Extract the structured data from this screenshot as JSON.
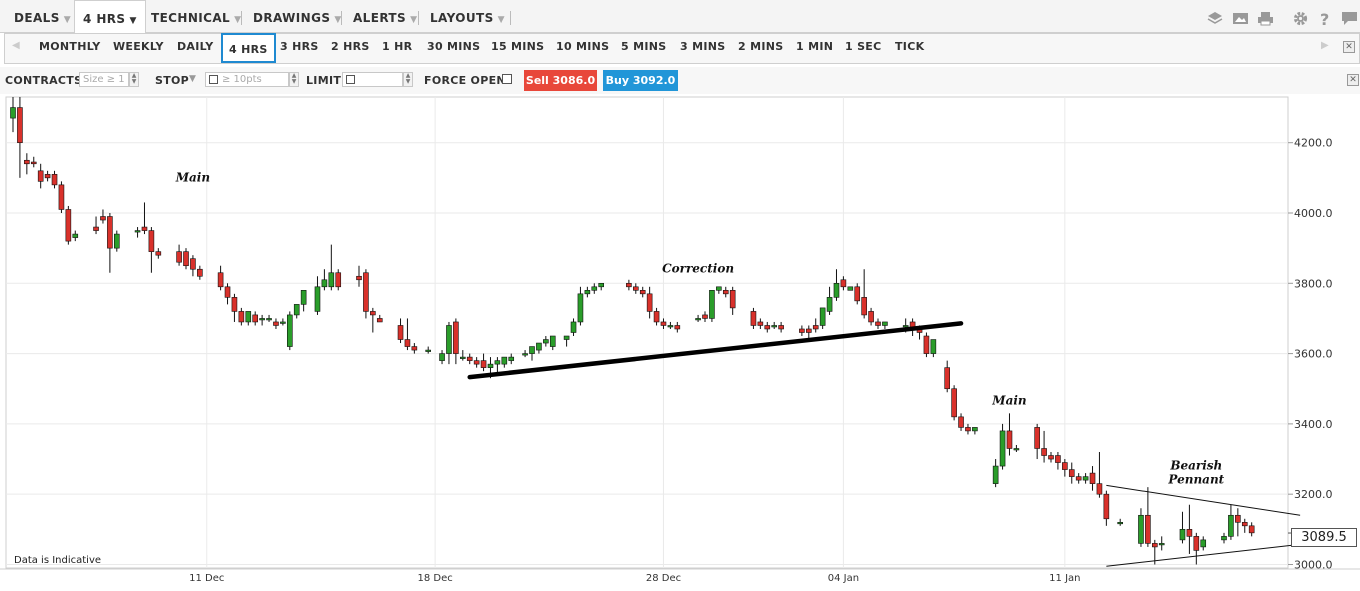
{
  "menus": [
    {
      "label": "DEALS",
      "active": false
    },
    {
      "label": "4 HRS",
      "active": true
    },
    {
      "label": "TECHNICAL",
      "active": false
    },
    {
      "label": "DRAWINGS",
      "active": false
    },
    {
      "label": "ALERTS",
      "active": false
    },
    {
      "label": "LAYOUTS",
      "active": false
    }
  ],
  "toolbar_icons": [
    "layers-icon",
    "image-icon",
    "print-icon",
    "gear-icon",
    "help-icon",
    "chat-icon"
  ],
  "timeframes": [
    "MONTHLY",
    "WEEKLY",
    "DAILY",
    "4 HRS",
    "3 HRS",
    "2 HRS",
    "1 HR",
    "30 MINS",
    "15 MINS",
    "10 MINS",
    "5 MINS",
    "3 MINS",
    "2 MINS",
    "1 MIN",
    "1 SEC",
    "TICK"
  ],
  "selected_timeframe": "4 HRS",
  "order": {
    "contracts_label": "CONTRACTS",
    "contracts_placeholder": "Size ≥ 1",
    "stop_label": "STOP",
    "stop_placeholder": "≥ 10pts",
    "limit_label": "LIMIT",
    "force_open_label": "FORCE OPEN",
    "sell_label": "Sell 3086.0",
    "buy_label": "Buy 3092.0",
    "sell_color": "#e8473a",
    "buy_color": "#2196d8"
  },
  "disclaimer": "Data is Indicative",
  "current_price": "3089.5",
  "chart_data": {
    "type": "candlestick",
    "title": "",
    "xlabel": "",
    "ylabel": "",
    "ylim": [
      2990,
      4330
    ],
    "yticks": [
      3000,
      3200,
      3400,
      3600,
      3800,
      4000,
      4200
    ],
    "ytick_labels": [
      "3000.0",
      "3200.0",
      "3400.0",
      "3600.0",
      "3800.0",
      "4000.0",
      "4200.0"
    ],
    "xticks": [
      {
        "label": "11 Dec",
        "index": 28
      },
      {
        "label": "18 Dec",
        "index": 61
      },
      {
        "label": "28 Dec",
        "index": 94
      },
      {
        "label": "04 Jan",
        "index": 120
      },
      {
        "label": "11 Jan",
        "index": 152
      }
    ],
    "grid": true,
    "bar_count": 179,
    "candles": [
      [
        0,
        4270,
        4330,
        4300,
        4230
      ],
      [
        1,
        4300,
        4330,
        4200,
        4100
      ],
      [
        2,
        4150,
        4170,
        4140,
        4110
      ],
      [
        3,
        4145,
        4160,
        4140,
        4130
      ],
      [
        4,
        4120,
        4140,
        4090,
        4070
      ],
      [
        5,
        4110,
        4120,
        4100,
        4090
      ],
      [
        6,
        4110,
        4120,
        4080,
        4070
      ],
      [
        7,
        4080,
        4090,
        4010,
        4000
      ],
      [
        8,
        4010,
        4020,
        3920,
        3910
      ],
      [
        9,
        3930,
        3950,
        3940,
        3920
      ],
      [
        12,
        3960,
        3990,
        3950,
        3940
      ],
      [
        13,
        3990,
        4010,
        3980,
        3970
      ],
      [
        14,
        3990,
        4000,
        3900,
        3830
      ],
      [
        15,
        3900,
        3950,
        3940,
        3890
      ],
      [
        18,
        3950,
        3960,
        3950,
        3930
      ],
      [
        19,
        3960,
        4030,
        3950,
        3940
      ],
      [
        20,
        3950,
        3960,
        3890,
        3830
      ],
      [
        21,
        3890,
        3900,
        3880,
        3870
      ],
      [
        24,
        3890,
        3910,
        3860,
        3850
      ],
      [
        25,
        3890,
        3900,
        3850,
        3840
      ],
      [
        26,
        3870,
        3880,
        3840,
        3820
      ],
      [
        27,
        3840,
        3850,
        3820,
        3810
      ],
      [
        30,
        3830,
        3850,
        3790,
        3780
      ],
      [
        31,
        3790,
        3800,
        3760,
        3740
      ],
      [
        32,
        3760,
        3770,
        3720,
        3690
      ],
      [
        33,
        3720,
        3730,
        3690,
        3680
      ],
      [
        34,
        3690,
        3700,
        3720,
        3680
      ],
      [
        35,
        3710,
        3720,
        3690,
        3680
      ],
      [
        36,
        3700,
        3710,
        3700,
        3680
      ],
      [
        37,
        3700,
        3710,
        3700,
        3690
      ],
      [
        38,
        3690,
        3700,
        3680,
        3670
      ],
      [
        39,
        3690,
        3700,
        3690,
        3680
      ],
      [
        40,
        3620,
        3720,
        3710,
        3610
      ],
      [
        41,
        3710,
        3740,
        3740,
        3700
      ],
      [
        42,
        3740,
        3760,
        3780,
        3720
      ],
      [
        44,
        3720,
        3820,
        3790,
        3710
      ],
      [
        45,
        3790,
        3840,
        3810,
        3780
      ],
      [
        46,
        3790,
        3910,
        3830,
        3780
      ],
      [
        47,
        3830,
        3840,
        3790,
        3780
      ],
      [
        50,
        3820,
        3850,
        3810,
        3790
      ],
      [
        51,
        3830,
        3840,
        3720,
        3700
      ],
      [
        52,
        3720,
        3730,
        3710,
        3660
      ],
      [
        53,
        3700,
        3710,
        3690,
        3690
      ],
      [
        56,
        3680,
        3700,
        3640,
        3630
      ],
      [
        57,
        3640,
        3700,
        3620,
        3610
      ],
      [
        58,
        3620,
        3630,
        3610,
        3600
      ],
      [
        60,
        3610,
        3620,
        3610,
        3600
      ],
      [
        62,
        3580,
        3610,
        3600,
        3570
      ],
      [
        63,
        3600,
        3690,
        3680,
        3570
      ],
      [
        64,
        3690,
        3700,
        3600,
        3570
      ],
      [
        65,
        3590,
        3610,
        3590,
        3580
      ],
      [
        66,
        3590,
        3600,
        3580,
        3570
      ],
      [
        67,
        3580,
        3590,
        3570,
        3560
      ],
      [
        68,
        3580,
        3600,
        3560,
        3550
      ],
      [
        69,
        3560,
        3590,
        3570,
        3530
      ],
      [
        70,
        3570,
        3590,
        3580,
        3540
      ],
      [
        71,
        3570,
        3590,
        3590,
        3560
      ],
      [
        72,
        3580,
        3600,
        3590,
        3570
      ],
      [
        74,
        3600,
        3610,
        3600,
        3590
      ],
      [
        75,
        3600,
        3620,
        3620,
        3580
      ],
      [
        76,
        3610,
        3630,
        3630,
        3600
      ],
      [
        77,
        3630,
        3650,
        3640,
        3620
      ],
      [
        78,
        3620,
        3630,
        3650,
        3610
      ],
      [
        80,
        3640,
        3650,
        3650,
        3620
      ],
      [
        81,
        3660,
        3700,
        3690,
        3650
      ],
      [
        82,
        3690,
        3790,
        3770,
        3680
      ],
      [
        83,
        3770,
        3790,
        3780,
        3760
      ],
      [
        84,
        3780,
        3800,
        3790,
        3770
      ],
      [
        85,
        3790,
        3800,
        3800,
        3780
      ],
      [
        89,
        3800,
        3810,
        3790,
        3780
      ],
      [
        90,
        3790,
        3800,
        3780,
        3770
      ],
      [
        91,
        3780,
        3790,
        3770,
        3760
      ],
      [
        92,
        3770,
        3790,
        3720,
        3700
      ],
      [
        93,
        3720,
        3730,
        3690,
        3680
      ],
      [
        94,
        3690,
        3700,
        3680,
        3670
      ],
      [
        95,
        3680,
        3690,
        3680,
        3670
      ],
      [
        96,
        3680,
        3690,
        3670,
        3660
      ],
      [
        99,
        3700,
        3710,
        3700,
        3690
      ],
      [
        100,
        3710,
        3720,
        3700,
        3690
      ],
      [
        101,
        3700,
        3710,
        3780,
        3690
      ],
      [
        102,
        3780,
        3790,
        3790,
        3770
      ],
      [
        103,
        3780,
        3790,
        3770,
        3760
      ],
      [
        104,
        3780,
        3790,
        3730,
        3710
      ],
      [
        107,
        3720,
        3730,
        3680,
        3670
      ],
      [
        108,
        3690,
        3700,
        3680,
        3670
      ],
      [
        109,
        3680,
        3690,
        3670,
        3660
      ],
      [
        110,
        3680,
        3690,
        3680,
        3670
      ],
      [
        111,
        3680,
        3690,
        3670,
        3660
      ],
      [
        114,
        3670,
        3680,
        3660,
        3650
      ],
      [
        115,
        3670,
        3680,
        3660,
        3640
      ],
      [
        116,
        3680,
        3700,
        3670,
        3660
      ],
      [
        117,
        3680,
        3720,
        3730,
        3670
      ],
      [
        118,
        3720,
        3790,
        3760,
        3710
      ],
      [
        119,
        3760,
        3840,
        3800,
        3750
      ],
      [
        120,
        3810,
        3820,
        3790,
        3780
      ],
      [
        121,
        3780,
        3790,
        3790,
        3780
      ],
      [
        122,
        3790,
        3800,
        3750,
        3740
      ],
      [
        123,
        3760,
        3840,
        3710,
        3700
      ],
      [
        124,
        3720,
        3730,
        3690,
        3680
      ],
      [
        125,
        3690,
        3700,
        3680,
        3670
      ],
      [
        126,
        3680,
        3690,
        3690,
        3670
      ],
      [
        129,
        3680,
        3700,
        3680,
        3660
      ],
      [
        130,
        3690,
        3700,
        3670,
        3650
      ],
      [
        131,
        3670,
        3680,
        3660,
        3640
      ],
      [
        132,
        3650,
        3660,
        3600,
        3590
      ],
      [
        133,
        3600,
        3610,
        3640,
        3590
      ],
      [
        135,
        3560,
        3580,
        3500,
        3490
      ],
      [
        136,
        3500,
        3510,
        3420,
        3410
      ],
      [
        137,
        3420,
        3430,
        3390,
        3380
      ],
      [
        138,
        3390,
        3400,
        3380,
        3370
      ],
      [
        139,
        3380,
        3390,
        3390,
        3370
      ],
      [
        142,
        3230,
        3300,
        3280,
        3220
      ],
      [
        143,
        3280,
        3400,
        3380,
        3270
      ],
      [
        144,
        3380,
        3430,
        3330,
        3310
      ],
      [
        145,
        3330,
        3340,
        3330,
        3320
      ],
      [
        148,
        3390,
        3400,
        3330,
        3300
      ],
      [
        149,
        3330,
        3380,
        3310,
        3290
      ],
      [
        150,
        3310,
        3320,
        3300,
        3290
      ],
      [
        151,
        3310,
        3320,
        3290,
        3270
      ],
      [
        152,
        3290,
        3300,
        3270,
        3250
      ],
      [
        153,
        3270,
        3290,
        3250,
        3230
      ],
      [
        154,
        3250,
        3260,
        3240,
        3230
      ],
      [
        155,
        3240,
        3260,
        3250,
        3230
      ],
      [
        156,
        3260,
        3280,
        3230,
        3210
      ],
      [
        157,
        3230,
        3320,
        3200,
        3190
      ],
      [
        158,
        3200,
        3210,
        3130,
        3110
      ],
      [
        160,
        3120,
        3130,
        3120,
        3110
      ],
      [
        163,
        3060,
        3160,
        3140,
        3050
      ],
      [
        164,
        3140,
        3220,
        3060,
        3050
      ],
      [
        165,
        3060,
        3070,
        3050,
        3000
      ],
      [
        166,
        3060,
        3080,
        3060,
        3040
      ],
      [
        169,
        3070,
        3150,
        3100,
        3060
      ],
      [
        170,
        3100,
        3170,
        3080,
        3030
      ],
      [
        171,
        3080,
        3090,
        3040,
        3000
      ],
      [
        172,
        3050,
        3080,
        3070,
        3040
      ],
      [
        175,
        3070,
        3090,
        3080,
        3060
      ],
      [
        176,
        3080,
        3170,
        3140,
        3070
      ],
      [
        177,
        3140,
        3160,
        3120,
        3080
      ],
      [
        178,
        3120,
        3130,
        3110,
        3090
      ],
      [
        179,
        3110,
        3120,
        3090,
        3080
      ]
    ],
    "trendline": {
      "from": {
        "index": 66,
        "price": 3533
      },
      "to": {
        "index": 137,
        "price": 3686
      }
    },
    "pennant_upper": {
      "from": {
        "index": 158,
        "price": 3225
      },
      "to": {
        "index": 186,
        "price": 3140
      }
    },
    "pennant_lower": {
      "from": {
        "index": 158,
        "price": 2995
      },
      "to": {
        "index": 185,
        "price": 3055
      }
    },
    "annotations": [
      {
        "text": "Main",
        "index": 26,
        "price": 4090
      },
      {
        "text": "Correction",
        "index": 99,
        "price": 3830
      },
      {
        "text": "Main",
        "index": 144,
        "price": 3455
      },
      {
        "text": "Bearish",
        "index": 171,
        "price": 3270
      },
      {
        "text": "Pennant",
        "index": 171,
        "price": 3230
      }
    ]
  }
}
